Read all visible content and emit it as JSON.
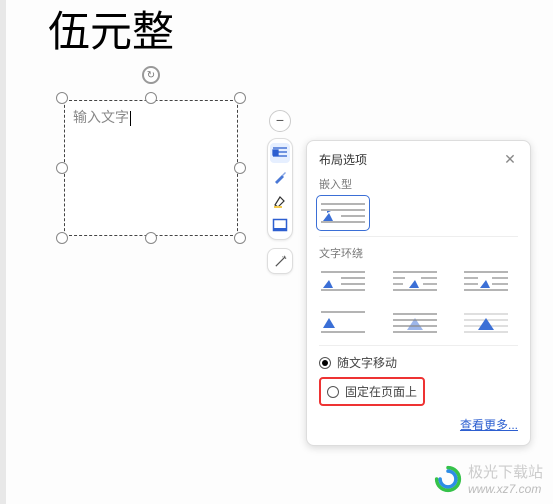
{
  "document": {
    "title_text": "伍元整",
    "textbox": {
      "placeholder": "输入文字"
    }
  },
  "vtoolbar": {
    "collapse_label": "−",
    "items": [
      {
        "name": "layout-options-icon",
        "active": true
      },
      {
        "name": "brush-icon",
        "active": false
      },
      {
        "name": "highlight-icon",
        "active": false
      },
      {
        "name": "frame-icon",
        "active": false
      }
    ],
    "magic_name": "magic-icon"
  },
  "panel": {
    "title": "布局选项",
    "close_label": "✕",
    "section_inline": "嵌入型",
    "section_wrap": "文字环绕",
    "inline_option": {
      "name": "inline-text",
      "selected": true
    },
    "wrap_options": [
      {
        "name": "square-wrap"
      },
      {
        "name": "tight-wrap"
      },
      {
        "name": "through-wrap"
      },
      {
        "name": "top-bottom-wrap"
      },
      {
        "name": "behind-text-wrap"
      },
      {
        "name": "in-front-wrap"
      }
    ],
    "radio_move": {
      "label": "随文字移动",
      "checked": true
    },
    "radio_fixed": {
      "label": "固定在页面上",
      "checked": false
    },
    "see_more": "查看更多..."
  },
  "watermark": {
    "cn": "极光下载站",
    "url": "www.xz7.com"
  }
}
